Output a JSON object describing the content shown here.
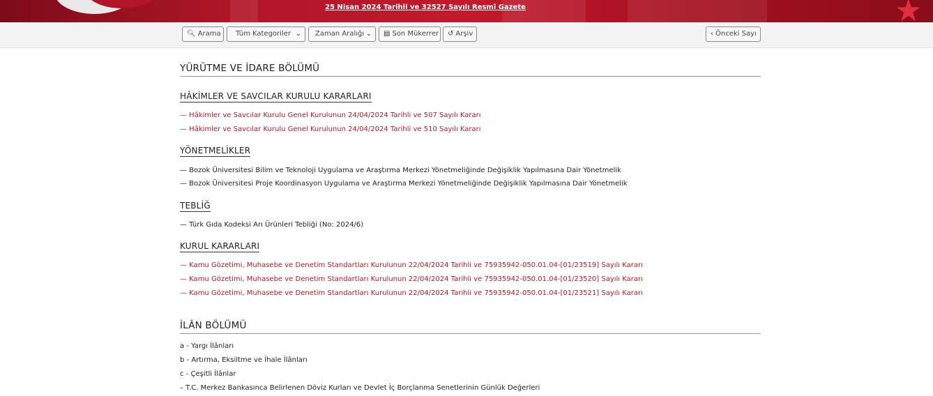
{
  "banner": {
    "gazette_link": "25 Nisan 2024 Tarihli ve 32527 Sayılı Resmî Gazete",
    "accent_color": "#b01627"
  },
  "toolbar": {
    "search_label": "Arama",
    "search_icon": "search-icon",
    "category_select": "Tüm Kategoriler",
    "time_range_select": "Zaman Aralığı",
    "repeats_label": "Son Mükerrer",
    "repeats_icon": "book-icon",
    "archive_label": "Arşiv",
    "archive_icon": "history-icon",
    "prev_issue_label": "Önceki Sayı",
    "prev_issue_icon": "chevron-left-icon"
  },
  "sections": {
    "executive": {
      "title": "YÜRÜTME VE İDARE BÖLÜMÜ",
      "hsk": {
        "title": "HÂKİMLER VE SAVCILAR KURULU KARARLARI",
        "items": [
          "— Hâkimler ve Savcılar Kurulu Genel Kurulunun 24/04/2024 Tarihli ve 507 Sayılı Kararı",
          "— Hâkimler ve Savcılar Kurulu Genel Kurulunun 24/04/2024 Tarihli ve 510 Sayılı Kararı"
        ]
      },
      "regulations": {
        "title": "YÖNETMELİKLER",
        "items": [
          "— Bozok Üniversitesi Bilim ve Teknoloji Uygulama ve Araştırma Merkezi Yönetmeliğinde Değişiklik Yapılmasına Dair Yönetmelik",
          "— Bozok Üniversitesi Proje Koordinasyon Uygulama ve Araştırma Merkezi Yönetmeliğinde Değişiklik Yapılmasına Dair Yönetmelik"
        ]
      },
      "communique": {
        "title": "TEBLİĞ",
        "items": [
          "— Türk Gıda Kodeksi Arı Ürünleri Tebliği (No: 2024/6)"
        ]
      },
      "board": {
        "title": "KURUL KARARLARI",
        "items": [
          "— Kamu Gözetimi, Muhasebe ve Denetim Standartları Kurulunun 22/04/2024 Tarihli ve 75935942-050.01.04-[01/23519] Sayılı Kararı",
          "— Kamu Gözetimi, Muhasebe ve Denetim Standartları Kurulunun 22/04/2024 Tarihli ve 75935942-050.01.04-[01/23520] Sayılı Kararı",
          "— Kamu Gözetimi, Muhasebe ve Denetim Standartları Kurulunun 22/04/2024 Tarihli ve 75935942-050.01.04-[01/23521] Sayılı Kararı"
        ]
      }
    },
    "announcements": {
      "title": "İLÂN BÖLÜMÜ",
      "items": [
        "a - Yargı İlânları",
        "b - Artırma, Eksiltme ve İhale İlânları",
        "c - Çeşitli İlânlar",
        "– T.C. Merkez Bankasınca Belirlenen Döviz Kurları ve Devlet İç Borçlanma Senetlerinin Günlük Değerleri"
      ]
    }
  }
}
